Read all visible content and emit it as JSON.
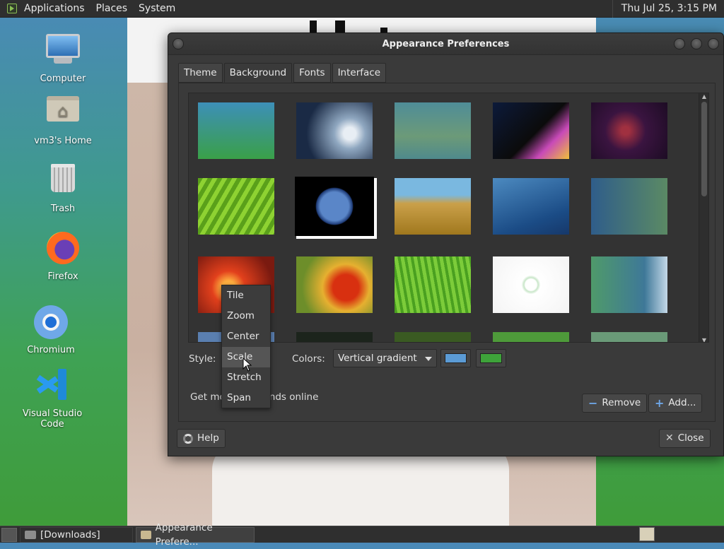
{
  "top_panel": {
    "menus": [
      "Applications",
      "Places",
      "System"
    ],
    "clock": "Thu Jul 25,  3:15 PM"
  },
  "desktop": {
    "icons": [
      {
        "label": "Computer",
        "icon": "computer-icon"
      },
      {
        "label": "vm3's Home",
        "icon": "home-folder-icon"
      },
      {
        "label": "Trash",
        "icon": "trash-icon"
      },
      {
        "label": "Firefox",
        "icon": "firefox-icon"
      },
      {
        "label": "Chromium",
        "icon": "chromium-icon"
      },
      {
        "label": "Visual Studio Code",
        "icon": "vscode-icon"
      }
    ]
  },
  "dialog": {
    "title": "Appearance Preferences",
    "tabs": [
      "Theme",
      "Background",
      "Fonts",
      "Interface"
    ],
    "active_tab": "Background",
    "wallpapers": [
      {
        "name": "gradient",
        "bg": "linear-gradient(180deg,#3d8fb8,#3aa048)"
      },
      {
        "name": "water-drop",
        "bg": "radial-gradient(circle at 70% 55%,#e8eef4 0 10%,#8fa7c0 25%,#1a2a45 70%)"
      },
      {
        "name": "teal-blur",
        "bg": "linear-gradient(180deg,#4f8d98,#6c9a78 60%,#4f8a8c)"
      },
      {
        "name": "arch-prism",
        "bg": "linear-gradient(135deg,#0c1a3a,#0b0b0b 55%,#c84ab8 75%,#f0c03a)"
      },
      {
        "name": "space-arch",
        "bg": "radial-gradient(circle at 45% 50%,#a03040 0 8%,#3a1440 40%,#1d0c24)"
      },
      {
        "name": "green-leaf",
        "bg": "repeating-linear-gradient(120deg,#5aa01a 0 6px,#8ed232 6px 12px)"
      },
      {
        "name": "earth",
        "bg": "radial-gradient(circle,#5a86c8 0 30%,#1f3c78 38%,#000 40%)"
      },
      {
        "name": "wheat",
        "bg": "linear-gradient(180deg,#7ab8e0 0 30%,#caa04a 45%,#a0781e)"
      },
      {
        "name": "blue-bubbles",
        "bg": "linear-gradient(160deg,#4c8ac0,#1b4c86 70%,#16386a)"
      },
      {
        "name": "green-blue-gradient",
        "bg": "linear-gradient(90deg,#2f5d8a,#5b8a64)"
      },
      {
        "name": "red-flower",
        "bg": "radial-gradient(circle at 40% 55%,#ffb040 0 12%,#e2401c 30%,#7a1a10 80%)"
      },
      {
        "name": "marigold",
        "bg": "radial-gradient(circle at 65% 55%,#d83010 0 22%,#e6b030 40%,#6d8e2a 75%)"
      },
      {
        "name": "grass",
        "bg": "repeating-linear-gradient(80deg,#4aa020 0 4px,#7ccc3a 4px 9px)"
      },
      {
        "name": "green-logo",
        "bg": "radial-gradient(circle at 50% 50%,#ffffff 0 12%,#c8e6c8 15%,#ffffff 20%,#f4f4f4)"
      },
      {
        "name": "green-teal-splash",
        "bg": "linear-gradient(90deg,#4f9a6a,#3e7898 70%,#c4d8e8)"
      }
    ],
    "style_label": "Style:",
    "colors_label": "Colors:",
    "colors_value": "Vertical gradient",
    "primary_color": "#5b9bd5",
    "secondary_color": "#3ea33a",
    "style_options": [
      "Tile",
      "Zoom",
      "Center",
      "Scale",
      "Stretch",
      "Span"
    ],
    "style_selected": "Scale",
    "get_more_prefix": "Get mo",
    "get_more_suffix": "nds online",
    "remove_button": "Remove",
    "add_button": "Add...",
    "help_button": "Help",
    "close_button": "Close"
  },
  "taskbar": {
    "tasks": [
      "[Downloads]",
      "Appearance Prefere..."
    ]
  }
}
